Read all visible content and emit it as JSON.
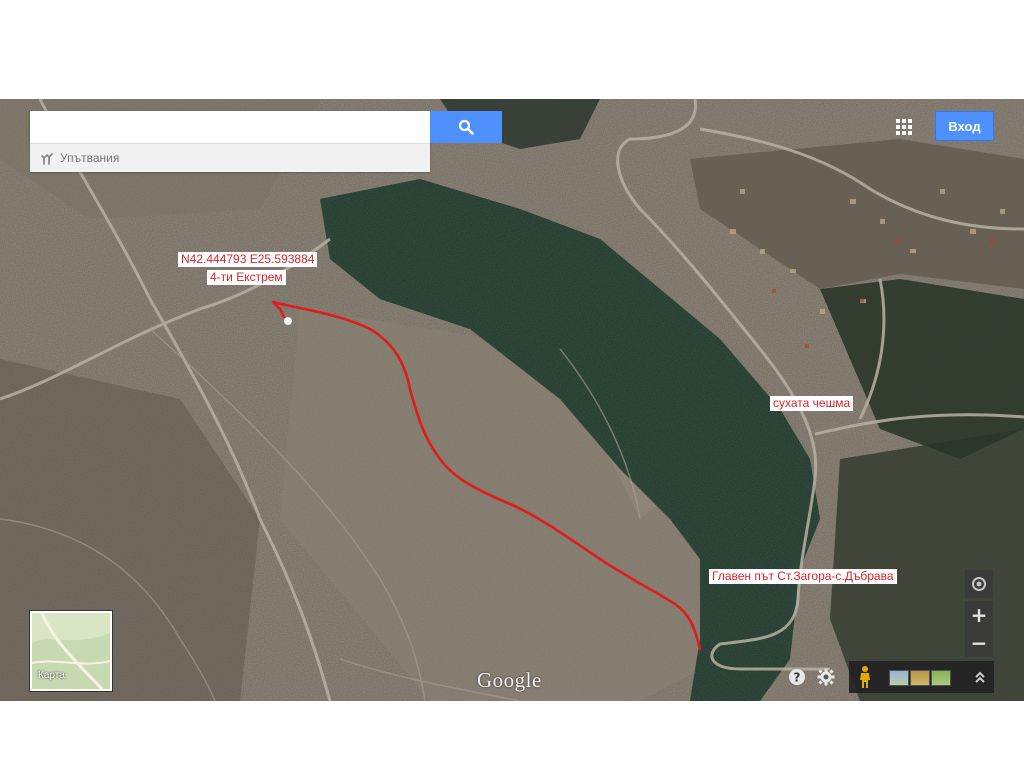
{
  "search": {
    "value": "",
    "placeholder": "",
    "directions_label": "Упътвания"
  },
  "header": {
    "signin_label": "Вход"
  },
  "map": {
    "type": "satellite",
    "labels": {
      "coordinates": "N42.444793    E25.593884",
      "place": "4-ти Екстрем",
      "fountain": "сухата чешма",
      "main_road": "Главен път Ст.Загора-с.Дъбрава"
    },
    "route_color": "#e01b1b",
    "label_color": "#d8232a",
    "branding": "Google"
  },
  "minimap": {
    "label": "Карта"
  },
  "controls": {
    "zoom_in": "+",
    "zoom_out": "−",
    "accent": "#4d90fe"
  },
  "icons": [
    "search-icon",
    "directions-icon",
    "apps-grid-icon",
    "help-icon",
    "settings-gear-icon",
    "my-location-icon",
    "pegman-icon",
    "expand-icon"
  ]
}
